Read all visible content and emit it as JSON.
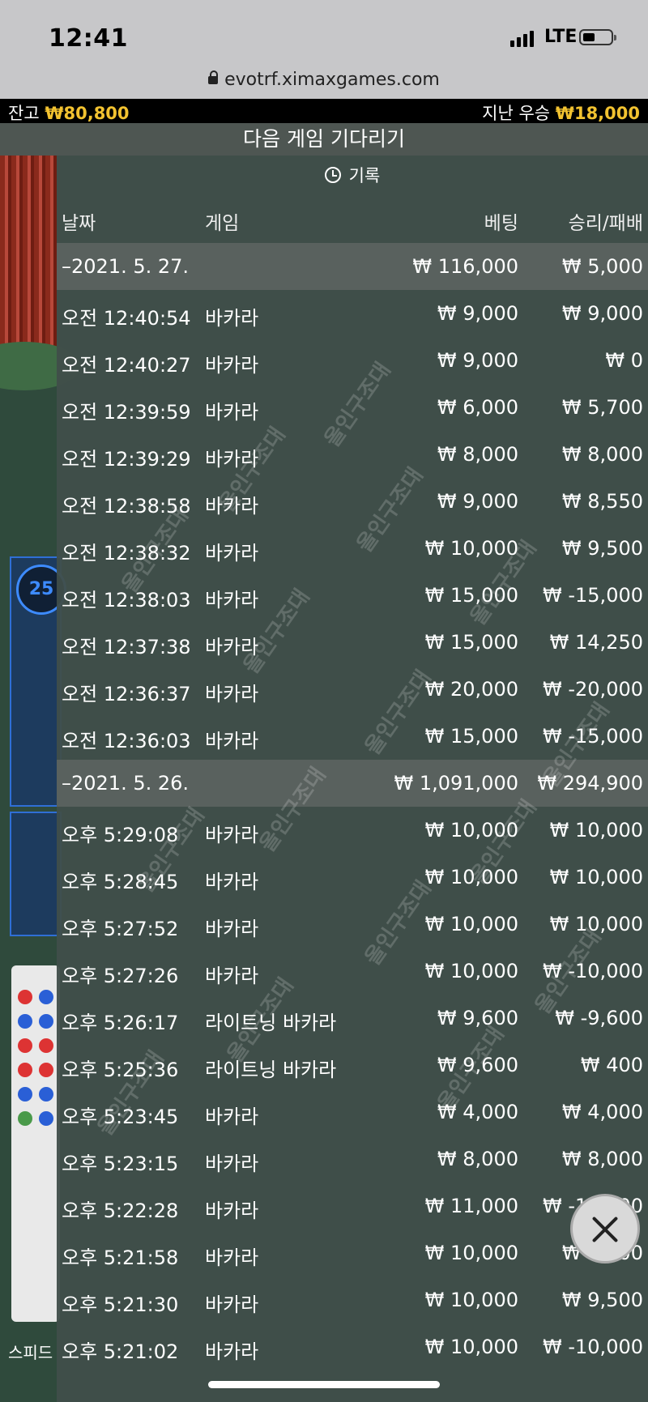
{
  "status": {
    "time": "12:41",
    "network": "LTE",
    "url": "evotrf.ximaxgames.com"
  },
  "balance_bar": {
    "balance_label": "잔고",
    "balance_value": "₩80,800",
    "last_win_label": "지난 우승",
    "last_win_value": "₩18,000",
    "accent": "#f2c230"
  },
  "title": "다음 게임 기다리기",
  "history": {
    "heading": "기록",
    "columns": {
      "date": "날짜",
      "game": "게임",
      "bet": "베팅",
      "result": "승리/패배"
    },
    "groups": [
      {
        "date": "–2021. 5. 27.",
        "bet_total": "₩ 116,000",
        "result_total": "₩ 5,000",
        "rows": [
          {
            "time": "오전 12:40:54",
            "game": "바카라",
            "bet": "₩ 9,000",
            "result": "₩ 9,000"
          },
          {
            "time": "오전 12:40:27",
            "game": "바카라",
            "bet": "₩ 9,000",
            "result": "₩ 0"
          },
          {
            "time": "오전 12:39:59",
            "game": "바카라",
            "bet": "₩ 6,000",
            "result": "₩ 5,700"
          },
          {
            "time": "오전 12:39:29",
            "game": "바카라",
            "bet": "₩ 8,000",
            "result": "₩ 8,000"
          },
          {
            "time": "오전 12:38:58",
            "game": "바카라",
            "bet": "₩ 9,000",
            "result": "₩ 8,550"
          },
          {
            "time": "오전 12:38:32",
            "game": "바카라",
            "bet": "₩ 10,000",
            "result": "₩ 9,500"
          },
          {
            "time": "오전 12:38:03",
            "game": "바카라",
            "bet": "₩ 15,000",
            "result": "₩ -15,000"
          },
          {
            "time": "오전 12:37:38",
            "game": "바카라",
            "bet": "₩ 15,000",
            "result": "₩ 14,250"
          },
          {
            "time": "오전 12:36:37",
            "game": "바카라",
            "bet": "₩ 20,000",
            "result": "₩ -20,000"
          },
          {
            "time": "오전 12:36:03",
            "game": "바카라",
            "bet": "₩ 15,000",
            "result": "₩ -15,000"
          }
        ]
      },
      {
        "date": "–2021. 5. 26.",
        "bet_total": "₩ 1,091,000",
        "result_total": "₩ 294,900",
        "rows": [
          {
            "time": "오후 5:29:08",
            "game": "바카라",
            "bet": "₩ 10,000",
            "result": "₩ 10,000"
          },
          {
            "time": "오후 5:28:45",
            "game": "바카라",
            "bet": "₩ 10,000",
            "result": "₩ 10,000"
          },
          {
            "time": "오후 5:27:52",
            "game": "바카라",
            "bet": "₩ 10,000",
            "result": "₩ 10,000"
          },
          {
            "time": "오후 5:27:26",
            "game": "바카라",
            "bet": "₩ 10,000",
            "result": "₩ -10,000"
          },
          {
            "time": "오후 5:26:17",
            "game": "라이트닝 바카라",
            "bet": "₩ 9,600",
            "result": "₩ -9,600"
          },
          {
            "time": "오후 5:25:36",
            "game": "라이트닝 바카라",
            "bet": "₩ 9,600",
            "result": "₩ 400"
          },
          {
            "time": "오후 5:23:45",
            "game": "바카라",
            "bet": "₩ 4,000",
            "result": "₩ 4,000"
          },
          {
            "time": "오후 5:23:15",
            "game": "바카라",
            "bet": "₩ 8,000",
            "result": "₩ 8,000"
          },
          {
            "time": "오후 5:22:28",
            "game": "바카라",
            "bet": "₩ 11,000",
            "result": "₩ -11,000"
          },
          {
            "time": "오후 5:21:58",
            "game": "바카라",
            "bet": "₩ 10,000",
            "result": "₩ 9,500"
          },
          {
            "time": "오후 5:21:30",
            "game": "바카라",
            "bet": "₩ 10,000",
            "result": "₩ 9,500"
          },
          {
            "time": "오후 5:21:02",
            "game": "바카라",
            "bet": "₩ 10,000",
            "result": "₩ -10,000"
          }
        ]
      }
    ]
  },
  "watermark": "올인구조대",
  "background": {
    "counter": "25",
    "bottom_label": "스피드"
  }
}
